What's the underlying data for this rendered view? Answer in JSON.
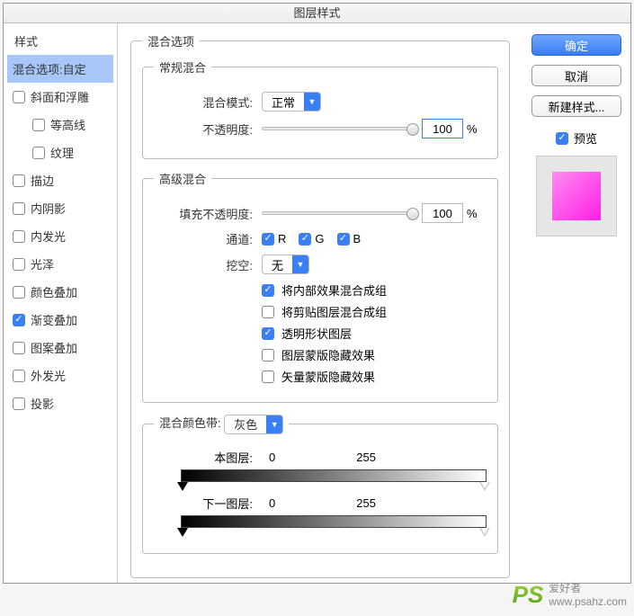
{
  "title": "图层样式",
  "sidebar": {
    "header": "样式",
    "items": [
      {
        "label": "混合选项:自定",
        "checked": null,
        "selected": true
      },
      {
        "label": "斜面和浮雕",
        "checked": false
      },
      {
        "label": "等高线",
        "checked": false,
        "indent": true
      },
      {
        "label": "纹理",
        "checked": false,
        "indent": true
      },
      {
        "label": "描边",
        "checked": false
      },
      {
        "label": "内阴影",
        "checked": false
      },
      {
        "label": "内发光",
        "checked": false
      },
      {
        "label": "光泽",
        "checked": false
      },
      {
        "label": "颜色叠加",
        "checked": false
      },
      {
        "label": "渐变叠加",
        "checked": true
      },
      {
        "label": "图案叠加",
        "checked": false
      },
      {
        "label": "外发光",
        "checked": false
      },
      {
        "label": "投影",
        "checked": false
      }
    ]
  },
  "blending": {
    "group": "混合选项",
    "general": {
      "group": "常规混合",
      "mode_label": "混合模式:",
      "mode_value": "正常",
      "opacity_label": "不透明度:",
      "opacity_value": "100",
      "pct": "%"
    },
    "advanced": {
      "group": "高级混合",
      "fill_label": "填充不透明度:",
      "fill_value": "100",
      "pct": "%",
      "channels_label": "通道:",
      "ch_r": "R",
      "ch_g": "G",
      "ch_b": "B",
      "knockout_label": "挖空:",
      "knockout_value": "无",
      "opts": [
        {
          "label": "将内部效果混合成组",
          "checked": true
        },
        {
          "label": "将剪贴图层混合成组",
          "checked": false
        },
        {
          "label": "透明形状图层",
          "checked": true
        },
        {
          "label": "图层蒙版隐藏效果",
          "checked": false
        },
        {
          "label": "矢量蒙版隐藏效果",
          "checked": false
        }
      ]
    },
    "blendif": {
      "group_label": "混合颜色带:",
      "channel": "灰色",
      "this_label": "本图层:",
      "this_lo": "0",
      "this_hi": "255",
      "under_label": "下一图层:",
      "under_lo": "0",
      "under_hi": "255"
    }
  },
  "buttons": {
    "ok": "确定",
    "cancel": "取消",
    "newstyle": "新建样式...",
    "preview": "预览"
  },
  "watermark": {
    "brand": "PS",
    "cn": "爱好者",
    "url": "www.psahz.com"
  }
}
